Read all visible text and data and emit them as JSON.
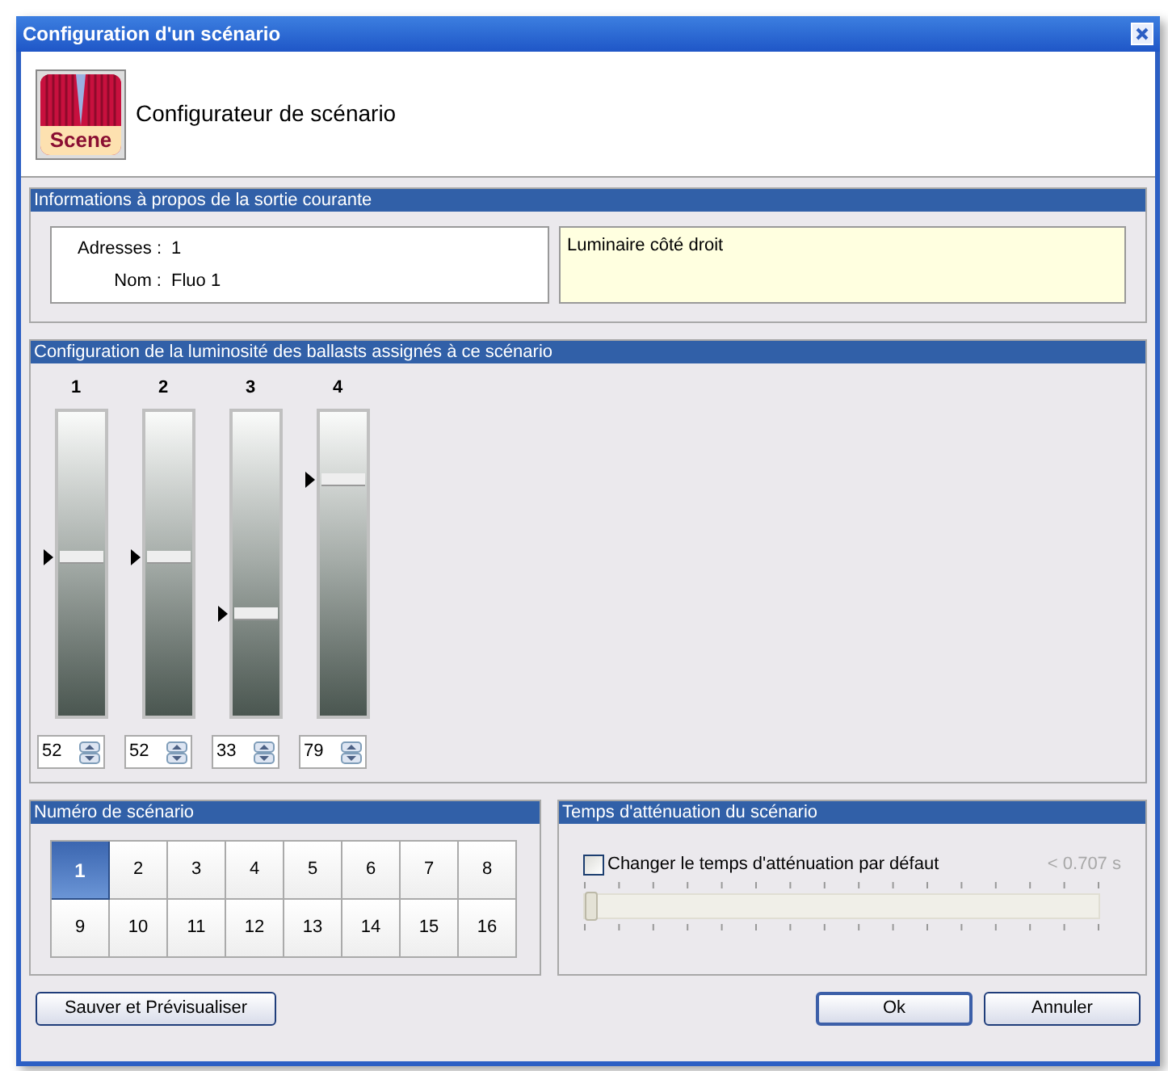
{
  "window": {
    "title": "Configuration d'un scénario"
  },
  "header": {
    "title": "Configurateur de scénario",
    "icon_label": "Scene"
  },
  "output_info": {
    "title": "Informations à propos de la sortie courante",
    "fields": [
      {
        "label": "Adresses :",
        "value": "1"
      },
      {
        "label": "Nom :",
        "value": "Fluo 1"
      }
    ],
    "description": "Luminaire côté droit"
  },
  "ballasts": {
    "title": "Configuration de la luminosité des ballasts assignés à ce scénario",
    "channels": [
      {
        "label": "1",
        "level": 0.52,
        "value": "52"
      },
      {
        "label": "2",
        "level": 0.52,
        "value": "52"
      },
      {
        "label": "3",
        "level": 0.33,
        "value": "33"
      },
      {
        "label": "4",
        "level": 0.79,
        "value": "79"
      }
    ]
  },
  "scenario_number": {
    "title": "Numéro de scénario",
    "numbers": [
      {
        "label": "1",
        "selected": true
      },
      {
        "label": "2",
        "selected": false
      },
      {
        "label": "3",
        "selected": false
      },
      {
        "label": "4",
        "selected": false
      },
      {
        "label": "5",
        "selected": false
      },
      {
        "label": "6",
        "selected": false
      },
      {
        "label": "7",
        "selected": false
      },
      {
        "label": "8",
        "selected": false
      },
      {
        "label": "9",
        "selected": false
      },
      {
        "label": "10",
        "selected": false
      },
      {
        "label": "11",
        "selected": false
      },
      {
        "label": "12",
        "selected": false
      },
      {
        "label": "13",
        "selected": false
      },
      {
        "label": "14",
        "selected": false
      },
      {
        "label": "15",
        "selected": false
      },
      {
        "label": "16",
        "selected": false
      }
    ]
  },
  "fade_time": {
    "title": "Temps d'atténuation du scénario",
    "checkbox": {
      "label": "Changer le temps d'atténuation par défaut",
      "checked": false
    },
    "reading": "< 0.707 s",
    "level": 0
  },
  "left_buttons": [
    {
      "label": "Sauver et Prévisualiser",
      "default": false
    }
  ],
  "right_buttons": [
    {
      "label": "Ok",
      "default": true
    },
    {
      "label": "Annuler",
      "default": false
    }
  ]
}
